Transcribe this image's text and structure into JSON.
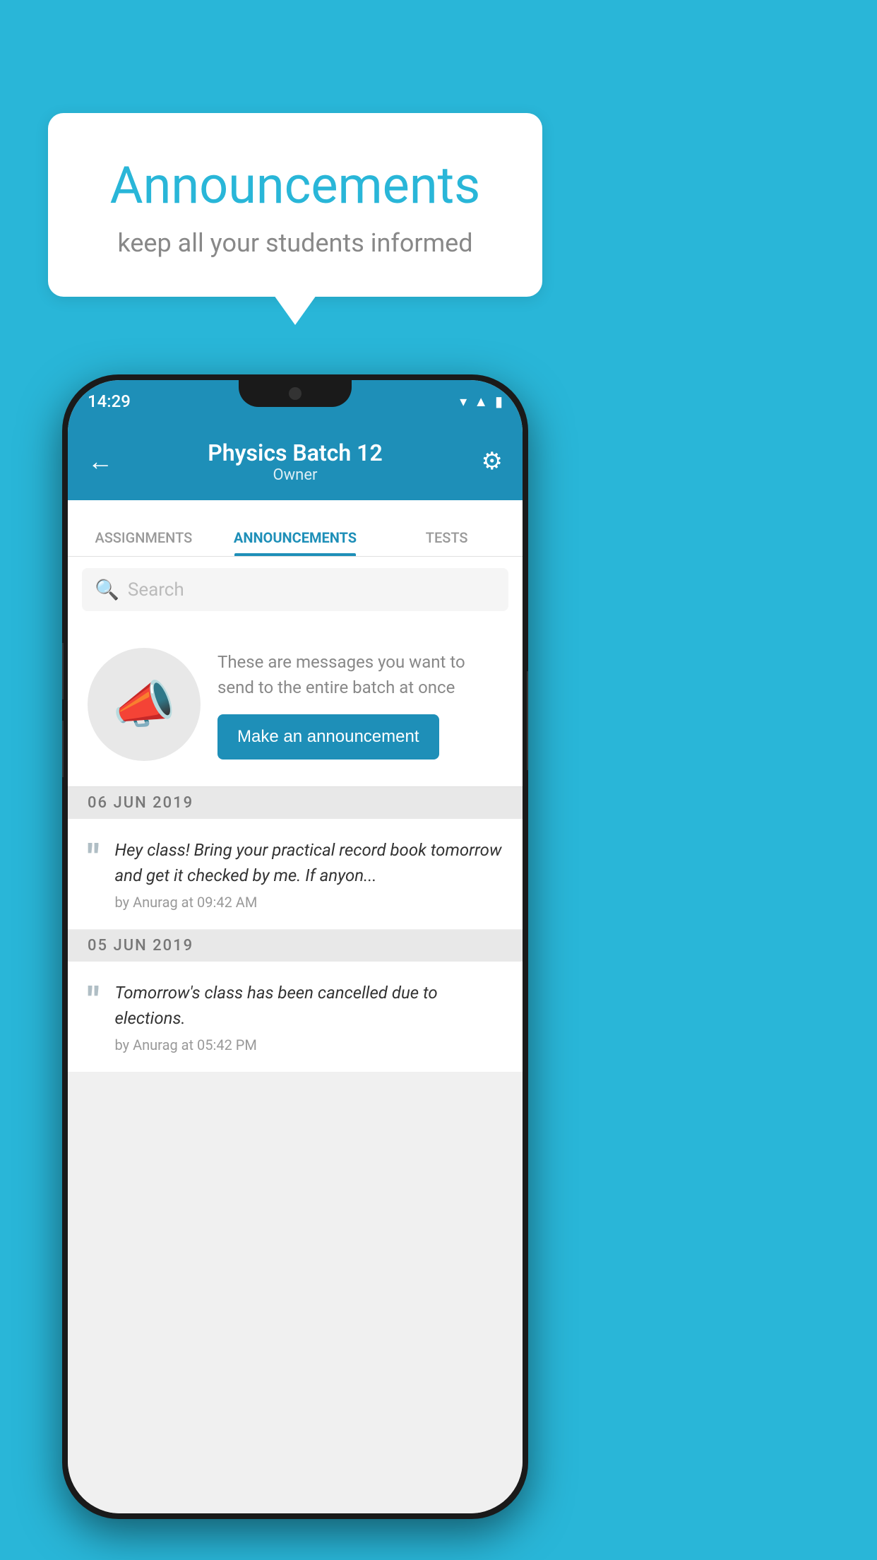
{
  "page": {
    "background_color": "#29b6d8"
  },
  "speech_bubble": {
    "title": "Announcements",
    "subtitle": "keep all your students informed"
  },
  "phone": {
    "status_bar": {
      "time": "14:29",
      "icons": [
        "wifi",
        "signal",
        "battery"
      ]
    },
    "app_bar": {
      "back_label": "←",
      "title": "Physics Batch 12",
      "subtitle": "Owner",
      "settings_label": "⚙"
    },
    "tabs": [
      {
        "label": "ASSIGNMENTS",
        "active": false
      },
      {
        "label": "ANNOUNCEMENTS",
        "active": true
      },
      {
        "label": "TESTS",
        "active": false
      }
    ],
    "search": {
      "placeholder": "Search"
    },
    "promo": {
      "description": "These are messages you want to send to the entire batch at once",
      "button_label": "Make an announcement"
    },
    "announcements": [
      {
        "date": "06  JUN  2019",
        "items": [
          {
            "body": "Hey class! Bring your practical record book tomorrow and get it checked by me. If anyon...",
            "meta": "by Anurag at 09:42 AM"
          }
        ]
      },
      {
        "date": "05  JUN  2019",
        "items": [
          {
            "body": "Tomorrow's class has been cancelled due to elections.",
            "meta": "by Anurag at 05:42 PM"
          }
        ]
      }
    ]
  }
}
